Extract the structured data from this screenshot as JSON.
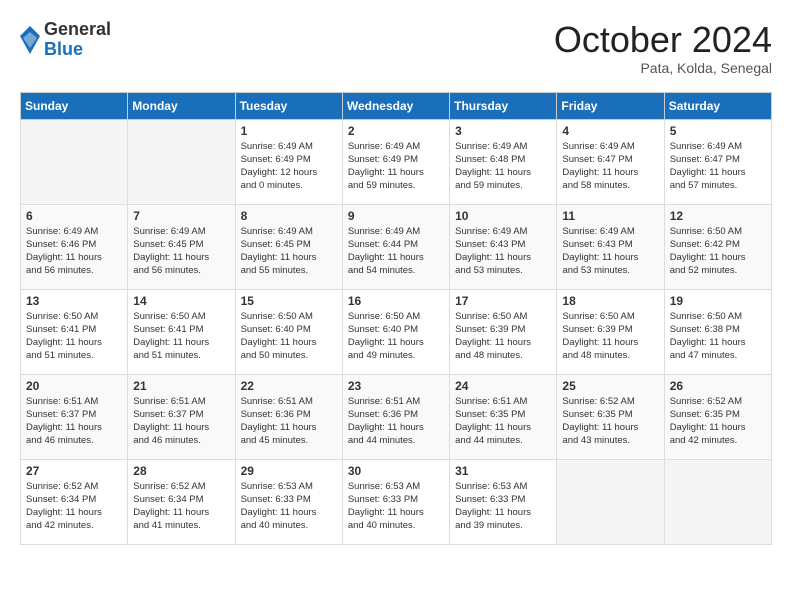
{
  "header": {
    "logo_general": "General",
    "logo_blue": "Blue",
    "month_title": "October 2024",
    "location": "Pata, Kolda, Senegal"
  },
  "weekdays": [
    "Sunday",
    "Monday",
    "Tuesday",
    "Wednesday",
    "Thursday",
    "Friday",
    "Saturday"
  ],
  "weeks": [
    [
      {
        "day": "",
        "info": ""
      },
      {
        "day": "",
        "info": ""
      },
      {
        "day": "1",
        "info": "Sunrise: 6:49 AM\nSunset: 6:49 PM\nDaylight: 12 hours\nand 0 minutes."
      },
      {
        "day": "2",
        "info": "Sunrise: 6:49 AM\nSunset: 6:49 PM\nDaylight: 11 hours\nand 59 minutes."
      },
      {
        "day": "3",
        "info": "Sunrise: 6:49 AM\nSunset: 6:48 PM\nDaylight: 11 hours\nand 59 minutes."
      },
      {
        "day": "4",
        "info": "Sunrise: 6:49 AM\nSunset: 6:47 PM\nDaylight: 11 hours\nand 58 minutes."
      },
      {
        "day": "5",
        "info": "Sunrise: 6:49 AM\nSunset: 6:47 PM\nDaylight: 11 hours\nand 57 minutes."
      }
    ],
    [
      {
        "day": "6",
        "info": "Sunrise: 6:49 AM\nSunset: 6:46 PM\nDaylight: 11 hours\nand 56 minutes."
      },
      {
        "day": "7",
        "info": "Sunrise: 6:49 AM\nSunset: 6:45 PM\nDaylight: 11 hours\nand 56 minutes."
      },
      {
        "day": "8",
        "info": "Sunrise: 6:49 AM\nSunset: 6:45 PM\nDaylight: 11 hours\nand 55 minutes."
      },
      {
        "day": "9",
        "info": "Sunrise: 6:49 AM\nSunset: 6:44 PM\nDaylight: 11 hours\nand 54 minutes."
      },
      {
        "day": "10",
        "info": "Sunrise: 6:49 AM\nSunset: 6:43 PM\nDaylight: 11 hours\nand 53 minutes."
      },
      {
        "day": "11",
        "info": "Sunrise: 6:49 AM\nSunset: 6:43 PM\nDaylight: 11 hours\nand 53 minutes."
      },
      {
        "day": "12",
        "info": "Sunrise: 6:50 AM\nSunset: 6:42 PM\nDaylight: 11 hours\nand 52 minutes."
      }
    ],
    [
      {
        "day": "13",
        "info": "Sunrise: 6:50 AM\nSunset: 6:41 PM\nDaylight: 11 hours\nand 51 minutes."
      },
      {
        "day": "14",
        "info": "Sunrise: 6:50 AM\nSunset: 6:41 PM\nDaylight: 11 hours\nand 51 minutes."
      },
      {
        "day": "15",
        "info": "Sunrise: 6:50 AM\nSunset: 6:40 PM\nDaylight: 11 hours\nand 50 minutes."
      },
      {
        "day": "16",
        "info": "Sunrise: 6:50 AM\nSunset: 6:40 PM\nDaylight: 11 hours\nand 49 minutes."
      },
      {
        "day": "17",
        "info": "Sunrise: 6:50 AM\nSunset: 6:39 PM\nDaylight: 11 hours\nand 48 minutes."
      },
      {
        "day": "18",
        "info": "Sunrise: 6:50 AM\nSunset: 6:39 PM\nDaylight: 11 hours\nand 48 minutes."
      },
      {
        "day": "19",
        "info": "Sunrise: 6:50 AM\nSunset: 6:38 PM\nDaylight: 11 hours\nand 47 minutes."
      }
    ],
    [
      {
        "day": "20",
        "info": "Sunrise: 6:51 AM\nSunset: 6:37 PM\nDaylight: 11 hours\nand 46 minutes."
      },
      {
        "day": "21",
        "info": "Sunrise: 6:51 AM\nSunset: 6:37 PM\nDaylight: 11 hours\nand 46 minutes."
      },
      {
        "day": "22",
        "info": "Sunrise: 6:51 AM\nSunset: 6:36 PM\nDaylight: 11 hours\nand 45 minutes."
      },
      {
        "day": "23",
        "info": "Sunrise: 6:51 AM\nSunset: 6:36 PM\nDaylight: 11 hours\nand 44 minutes."
      },
      {
        "day": "24",
        "info": "Sunrise: 6:51 AM\nSunset: 6:35 PM\nDaylight: 11 hours\nand 44 minutes."
      },
      {
        "day": "25",
        "info": "Sunrise: 6:52 AM\nSunset: 6:35 PM\nDaylight: 11 hours\nand 43 minutes."
      },
      {
        "day": "26",
        "info": "Sunrise: 6:52 AM\nSunset: 6:35 PM\nDaylight: 11 hours\nand 42 minutes."
      }
    ],
    [
      {
        "day": "27",
        "info": "Sunrise: 6:52 AM\nSunset: 6:34 PM\nDaylight: 11 hours\nand 42 minutes."
      },
      {
        "day": "28",
        "info": "Sunrise: 6:52 AM\nSunset: 6:34 PM\nDaylight: 11 hours\nand 41 minutes."
      },
      {
        "day": "29",
        "info": "Sunrise: 6:53 AM\nSunset: 6:33 PM\nDaylight: 11 hours\nand 40 minutes."
      },
      {
        "day": "30",
        "info": "Sunrise: 6:53 AM\nSunset: 6:33 PM\nDaylight: 11 hours\nand 40 minutes."
      },
      {
        "day": "31",
        "info": "Sunrise: 6:53 AM\nSunset: 6:33 PM\nDaylight: 11 hours\nand 39 minutes."
      },
      {
        "day": "",
        "info": ""
      },
      {
        "day": "",
        "info": ""
      }
    ]
  ]
}
